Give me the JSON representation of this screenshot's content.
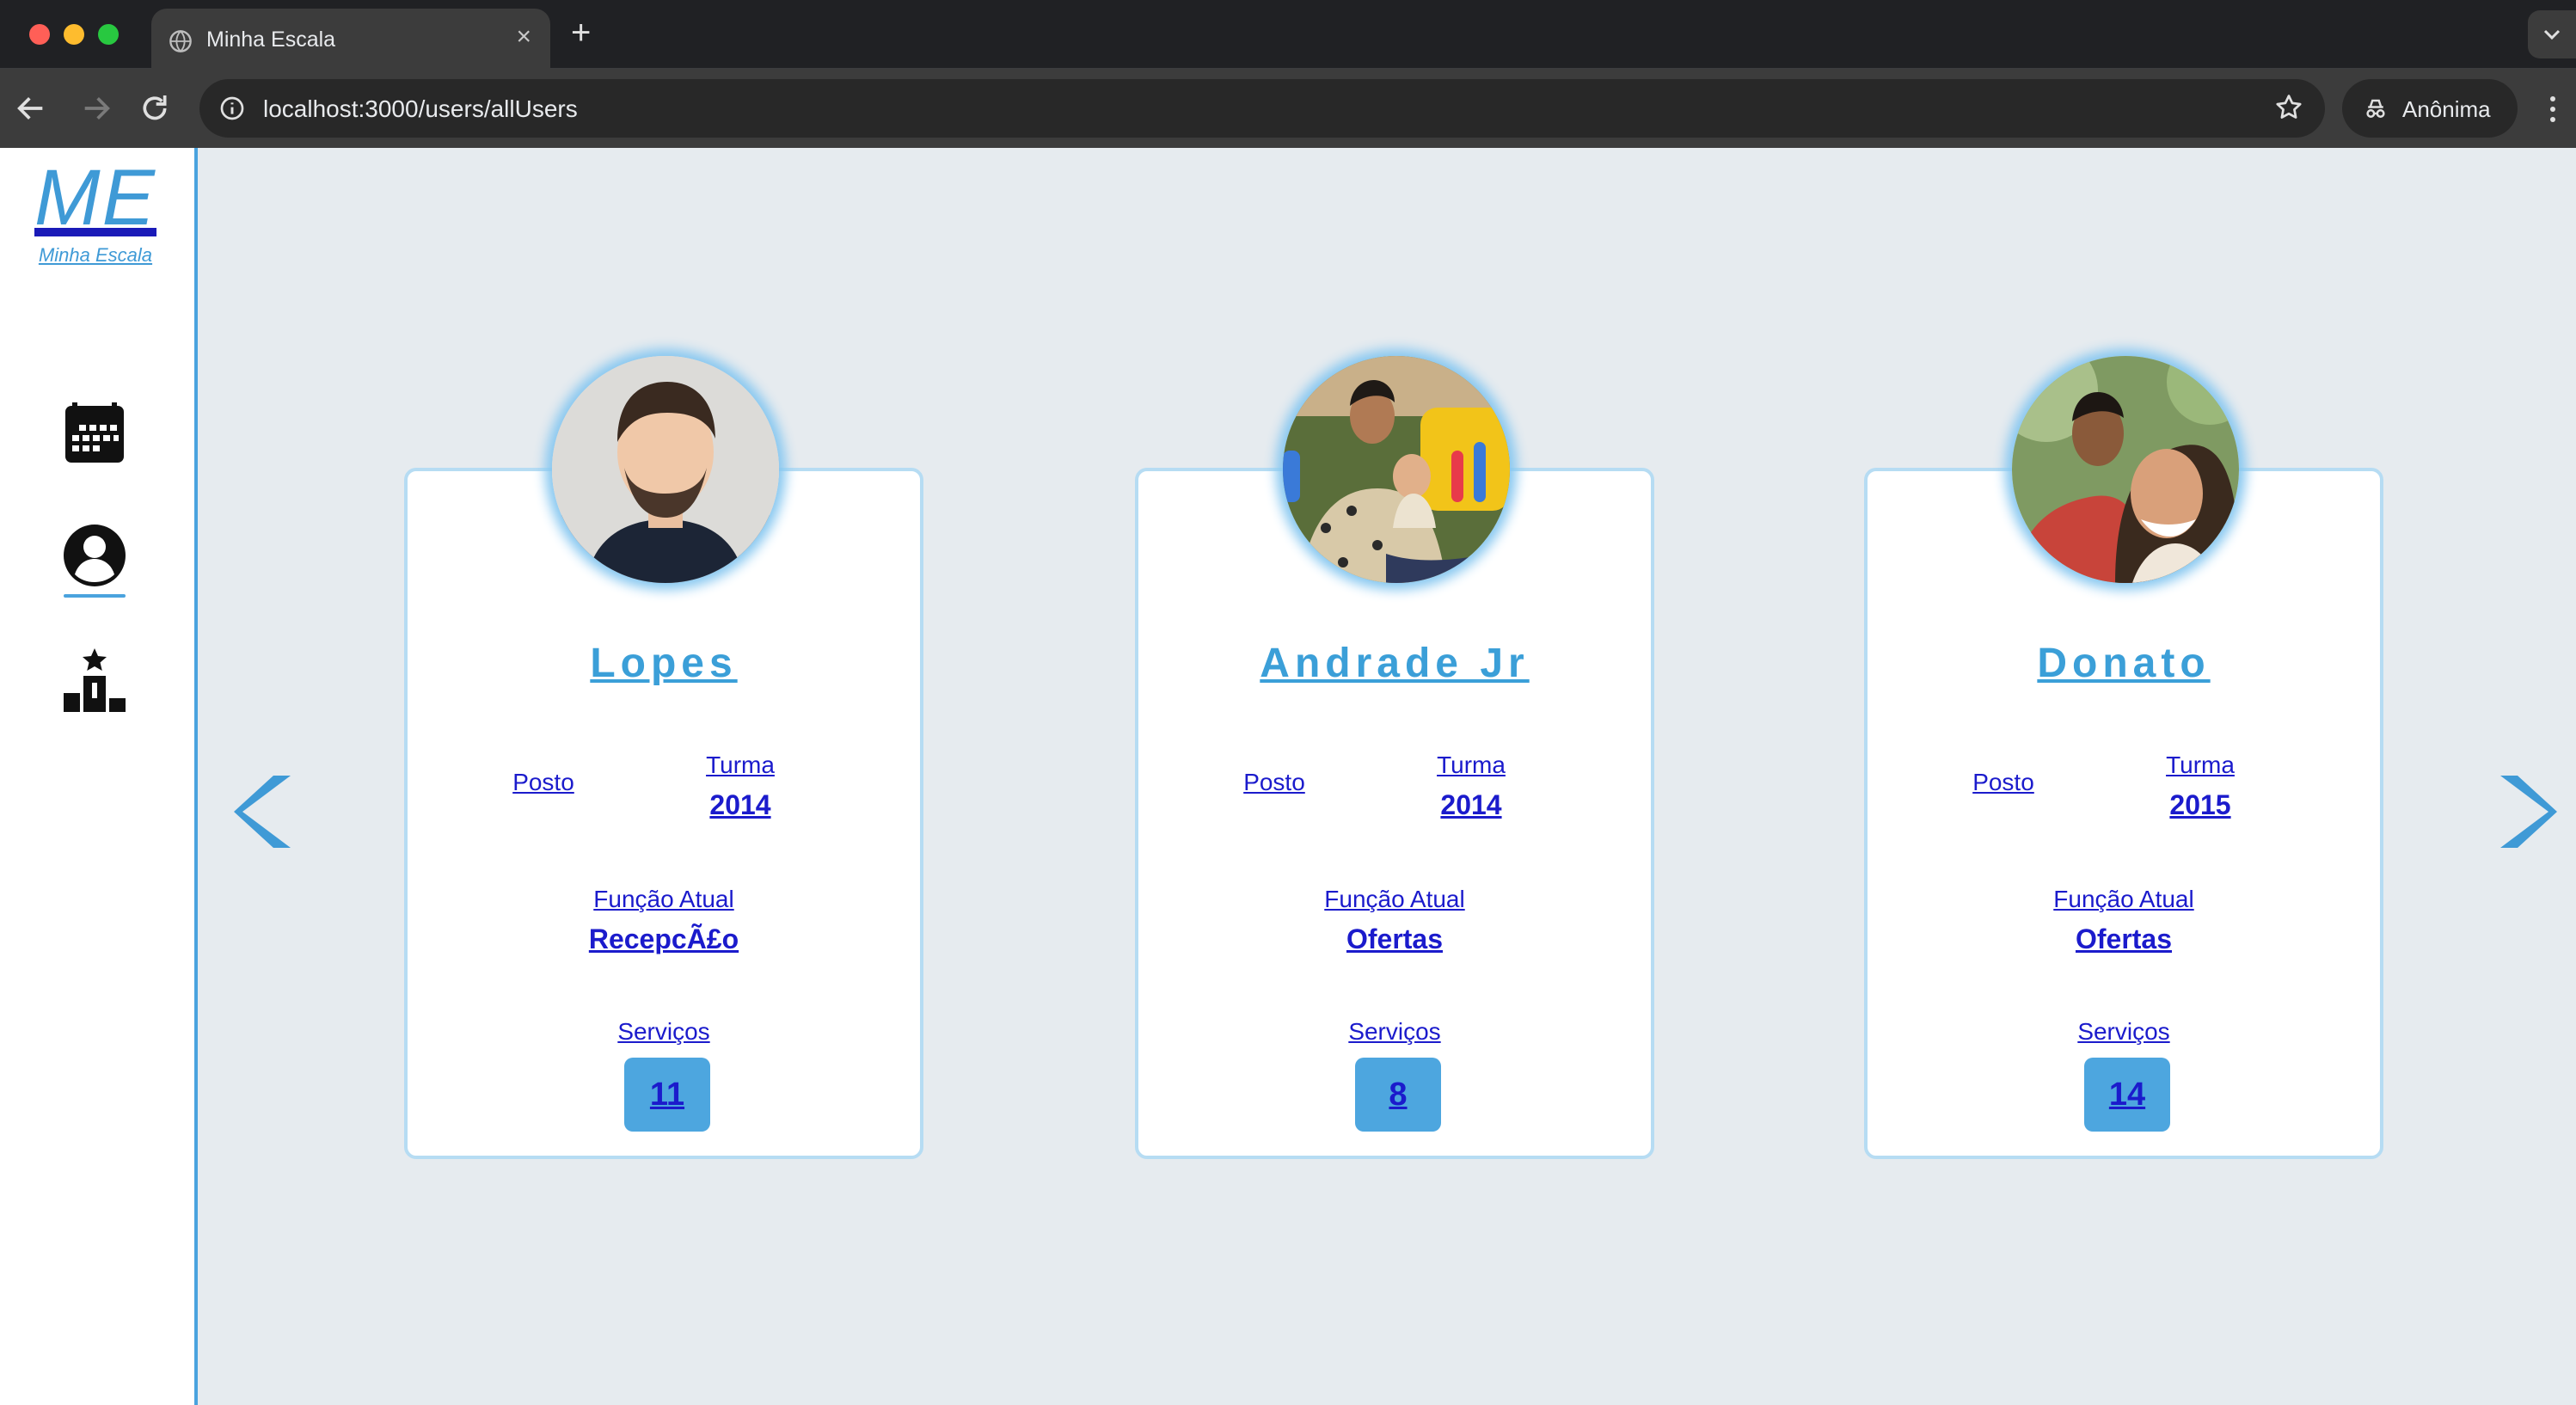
{
  "browser": {
    "tab_title": "Minha Escala",
    "new_tab_symbol": "+",
    "close_symbol": "×",
    "url": "localhost:3000/users/allUsers",
    "incognito_label": "Anônima"
  },
  "sidebar": {
    "logo_short": "ME",
    "logo_full": "Minha Escala",
    "items": [
      {
        "icon": "calendar-icon"
      },
      {
        "icon": "user-profile-icon",
        "active": true
      },
      {
        "icon": "podium-ranking-icon"
      }
    ]
  },
  "labels": {
    "posto": "Posto",
    "turma": "Turma",
    "funcao": "Função Atual",
    "servicos": "Serviços"
  },
  "cards": [
    {
      "name": "Lopes",
      "turma": "2014",
      "funcao": "RecepcÃ£o",
      "servicos": "11"
    },
    {
      "name": "Andrade Jr",
      "turma": "2014",
      "funcao": "Ofertas",
      "servicos": "8"
    },
    {
      "name": "Donato",
      "turma": "2015",
      "funcao": "Ofertas",
      "servicos": "14"
    }
  ],
  "colors": {
    "accent": "#4aa3de",
    "link": "#1b1bcc",
    "background": "#e6ebef"
  }
}
